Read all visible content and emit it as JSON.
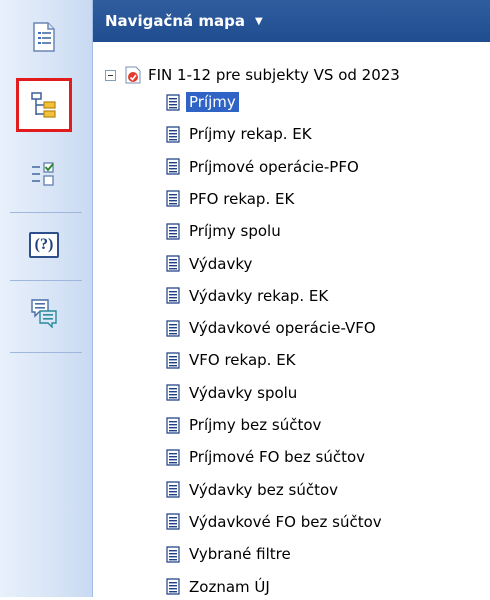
{
  "sidebar": {
    "buttons": [
      {
        "icon": "document-list-icon",
        "label": ""
      },
      {
        "icon": "tree-map-icon",
        "label": ""
      },
      {
        "icon": "checklist-icon",
        "label": ""
      },
      {
        "icon": "help-icon",
        "label": "(?)"
      },
      {
        "icon": "comments-icon",
        "label": ""
      }
    ]
  },
  "panel": {
    "title": "Navigačná mapa",
    "dropdown_glyph": "▼"
  },
  "tree": {
    "root_label": "FIN 1-12 pre subjekty VS od 2023",
    "items": [
      "Príjmy",
      "Príjmy rekap. EK",
      "Príjmové operácie-PFO",
      "PFO rekap. EK",
      "Príjmy spolu",
      "Výdavky",
      "Výdavky rekap. EK",
      "Výdavkové operácie-VFO",
      "VFO rekap. EK",
      "Výdavky spolu",
      "Príjmy bez súčtov",
      "Príjmové FO bez súčtov",
      "Výdavky bez súčtov",
      "Výdavkové FO bez súčtov",
      "Vybrané filtre",
      "Zoznam ÚJ"
    ],
    "selected_index": 0
  },
  "colors": {
    "accent": "#1f4d90",
    "selection": "#3063c6",
    "active_border": "#e21c1c"
  }
}
